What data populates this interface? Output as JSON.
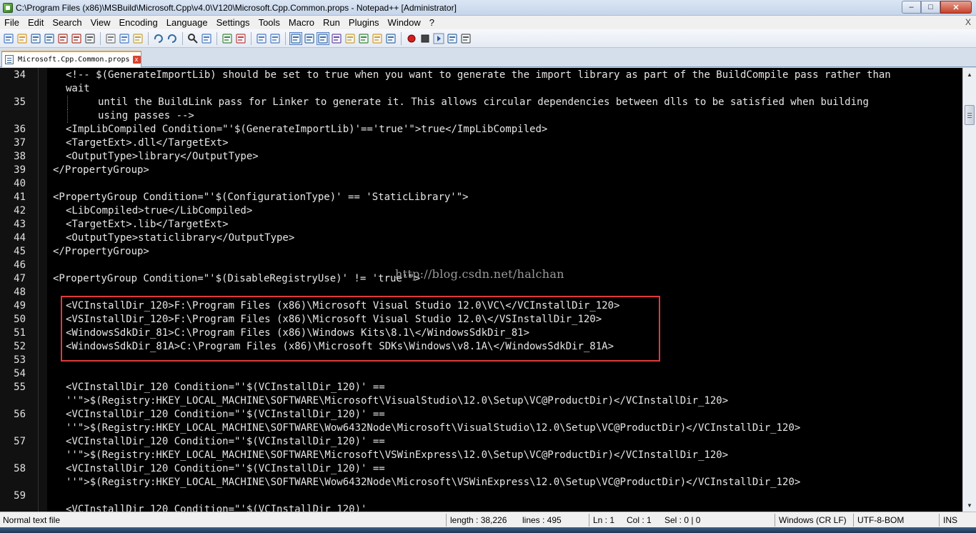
{
  "window": {
    "title": "C:\\Program Files (x86)\\MSBuild\\Microsoft.Cpp\\v4.0\\V120\\Microsoft.Cpp.Common.props - Notepad++ [Administrator]",
    "min_glyph": "–",
    "max_glyph": "□",
    "close_glyph": "✕"
  },
  "menu": {
    "items": [
      "File",
      "Edit",
      "Search",
      "View",
      "Encoding",
      "Language",
      "Settings",
      "Tools",
      "Macro",
      "Run",
      "Plugins",
      "Window",
      "?"
    ],
    "close_glyph": "X"
  },
  "tab": {
    "label": "Microsoft.Cpp.Common.props",
    "close_glyph": "x"
  },
  "editor": {
    "lines": [
      {
        "n": "34",
        "indent": 92,
        "text": "<!-- $(GenerateImportLib) should be set to true when you want to generate the import library as part of the BuildCompile pass rather than"
      },
      {
        "n": "",
        "indent": 92,
        "text": "wait"
      },
      {
        "n": "35",
        "indent": 137,
        "text": "until the BuildLink pass for Linker to generate it. This allows circular dependencies between dlls to be satisfied when building"
      },
      {
        "n": "",
        "indent": 137,
        "text": "using passes -->"
      },
      {
        "n": "36",
        "indent": 92,
        "text": "<ImpLibCompiled Condition=\"'$(GenerateImportLib)'=='true'\">true</ImpLibCompiled>"
      },
      {
        "n": "37",
        "indent": 92,
        "text": "<TargetExt>.dll</TargetExt>"
      },
      {
        "n": "38",
        "indent": 92,
        "text": "<OutputType>library</OutputType>"
      },
      {
        "n": "39",
        "indent": 74,
        "text": "</PropertyGroup>"
      },
      {
        "n": "40",
        "indent": 74,
        "text": ""
      },
      {
        "n": "41",
        "indent": 74,
        "text": "<PropertyGroup Condition=\"'$(ConfigurationType)' == 'StaticLibrary'\">"
      },
      {
        "n": "42",
        "indent": 92,
        "text": "<LibCompiled>true</LibCompiled>"
      },
      {
        "n": "43",
        "indent": 92,
        "text": "<TargetExt>.lib</TargetExt>"
      },
      {
        "n": "44",
        "indent": 92,
        "text": "<OutputType>staticlibrary</OutputType>"
      },
      {
        "n": "45",
        "indent": 74,
        "text": "</PropertyGroup>"
      },
      {
        "n": "46",
        "indent": 74,
        "text": ""
      },
      {
        "n": "47",
        "indent": 74,
        "text": "<PropertyGroup Condition=\"'$(DisableRegistryUse)' != 'true'\">"
      },
      {
        "n": "48",
        "indent": 74,
        "text": ""
      },
      {
        "n": "49",
        "indent": 92,
        "text": "<VCInstallDir_120>F:\\Program Files (x86)\\Microsoft Visual Studio 12.0\\VC\\</VCInstallDir_120>"
      },
      {
        "n": "50",
        "indent": 92,
        "text": "<VSInstallDir_120>F:\\Program Files (x86)\\Microsoft Visual Studio 12.0\\</VSInstallDir_120>"
      },
      {
        "n": "51",
        "indent": 92,
        "text": "<WindowsSdkDir_81>C:\\Program Files (x86)\\Windows Kits\\8.1\\</WindowsSdkDir_81>"
      },
      {
        "n": "52",
        "indent": 92,
        "text": "<WindowsSdkDir_81A>C:\\Program Files (x86)\\Microsoft SDKs\\Windows\\v8.1A\\</WindowsSdkDir_81A>"
      },
      {
        "n": "53",
        "indent": 92,
        "text": ""
      },
      {
        "n": "54",
        "indent": 92,
        "text": ""
      },
      {
        "n": "55",
        "indent": 92,
        "text": "<VCInstallDir_120 Condition=\"'$(VCInstallDir_120)' =="
      },
      {
        "n": "",
        "indent": 92,
        "text": "''\">$(Registry:HKEY_LOCAL_MACHINE\\SOFTWARE\\Microsoft\\VisualStudio\\12.0\\Setup\\VC@ProductDir)</VCInstallDir_120>"
      },
      {
        "n": "56",
        "indent": 92,
        "text": "<VCInstallDir_120 Condition=\"'$(VCInstallDir_120)' =="
      },
      {
        "n": "",
        "indent": 92,
        "text": "''\">$(Registry:HKEY_LOCAL_MACHINE\\SOFTWARE\\Wow6432Node\\Microsoft\\VisualStudio\\12.0\\Setup\\VC@ProductDir)</VCInstallDir_120>"
      },
      {
        "n": "57",
        "indent": 92,
        "text": "<VCInstallDir_120 Condition=\"'$(VCInstallDir_120)' =="
      },
      {
        "n": "",
        "indent": 92,
        "text": "''\">$(Registry:HKEY_LOCAL_MACHINE\\SOFTWARE\\Microsoft\\VSWinExpress\\12.0\\Setup\\VC@ProductDir)</VCInstallDir_120>"
      },
      {
        "n": "58",
        "indent": 92,
        "text": "<VCInstallDir_120 Condition=\"'$(VCInstallDir_120)' =="
      },
      {
        "n": "",
        "indent": 92,
        "text": "''\">$(Registry:HKEY_LOCAL_MACHINE\\SOFTWARE\\Wow6432Node\\Microsoft\\VSWinExpress\\12.0\\Setup\\VC@ProductDir)</VCInstallDir_120>"
      },
      {
        "n": "59",
        "indent": 92,
        "text": ""
      },
      {
        "n": "",
        "indent": 92,
        "text": "<VCInstallDir_120 Condition=\"'$(VCInstallDir_120)'"
      }
    ],
    "watermark": "http://blog.csdn.net/halchan"
  },
  "status": {
    "file_type": "Normal text file",
    "length": "length : 38,226",
    "lines": "lines : 495",
    "ln": "Ln : 1",
    "col": "Col : 1",
    "sel": "Sel : 0 | 0",
    "eol": "Windows (CR LF)",
    "encoding": "UTF-8-BOM",
    "mode": "INS"
  },
  "toolbar": {
    "icons": [
      "new-file-icon",
      "open-file-icon",
      "save-icon",
      "save-all-icon",
      "close-icon",
      "close-all-icon",
      "print-icon",
      "cut-icon",
      "copy-icon",
      "paste-icon",
      "undo-icon",
      "redo-icon",
      "find-icon",
      "replace-icon",
      "zoom-in-icon",
      "zoom-out-icon",
      "sync-vertical-icon",
      "sync-horizontal-icon",
      "word-wrap-icon",
      "show-all-chars-icon",
      "indent-guide-icon",
      "user-language-icon",
      "doc-map-icon",
      "function-list-icon",
      "folder-workspace-icon",
      "monitoring-icon",
      "record-macro-icon",
      "stop-record-icon",
      "play-macro-icon",
      "run-macro-multiple-icon",
      "save-macro-icon"
    ]
  },
  "colors": {
    "highlight_box": "#e03a3a",
    "editor_bg": "#000000",
    "tab_accent": "#f39c1f"
  }
}
